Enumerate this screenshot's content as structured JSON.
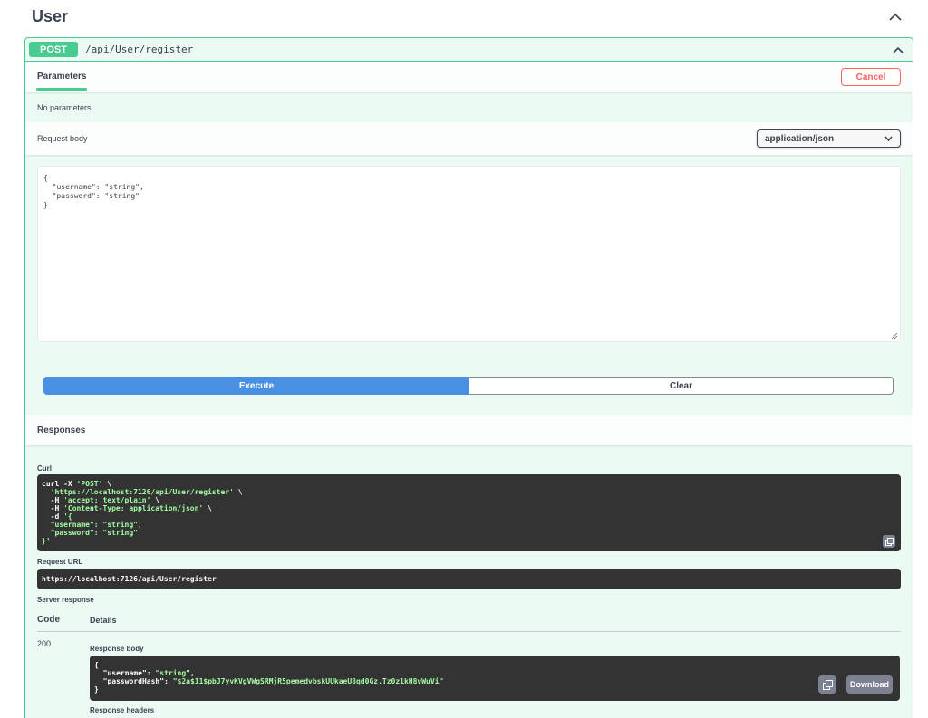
{
  "tag": {
    "title": "User"
  },
  "operation": {
    "method": "POST",
    "path": "/api/User/register"
  },
  "parameters": {
    "tab_label": "Parameters",
    "cancel_label": "Cancel",
    "no_params_text": "No parameters"
  },
  "request_body": {
    "label": "Request body",
    "content_type": "application/json",
    "editor_text": "{\n  \"username\": \"string\",\n  \"password\": \"string\"\n}"
  },
  "actions": {
    "execute_label": "Execute",
    "clear_label": "Clear"
  },
  "responses": {
    "title": "Responses",
    "curl_label": "Curl",
    "curl_lines": [
      {
        "plain": "curl -X ",
        "green": "'POST'",
        "rest": " \\"
      },
      {
        "plain": "  ",
        "green": "'https://localhost:7126/api/User/register'",
        "rest": " \\"
      },
      {
        "plain": "  -H ",
        "green": "'accept: text/plain'",
        "rest": " \\"
      },
      {
        "plain": "  -H ",
        "green": "'Content-Type: application/json'",
        "rest": " \\"
      },
      {
        "plain": "  -d ",
        "green": "'{",
        "rest": ""
      },
      {
        "plain": "",
        "green": "  \"username\": \"string\",",
        "rest": ""
      },
      {
        "plain": "",
        "green": "  \"password\": \"string\"",
        "rest": ""
      },
      {
        "plain": "",
        "green": "}'",
        "rest": ""
      }
    ],
    "request_url_label": "Request URL",
    "request_url": "https://localhost:7126/api/User/register",
    "server_response_label": "Server response",
    "code_header": "Code",
    "details_header": "Details",
    "code": "200",
    "response_body_label": "Response body",
    "response_body": {
      "open": "{",
      "line1_key": "  \"username\": ",
      "line1_val": "\"string\"",
      "line1_end": ",",
      "line2_key": "  \"passwordHash\": ",
      "line2_val": "\"$2a$11$pbJ7yvKVgVWgSRMjR5pemedvbskUUkaeU8qd0Gz.Tz0z1kH8vWuVi\"",
      "close": "}"
    },
    "download_label": "Download",
    "response_headers_label": "Response headers"
  },
  "icons": {
    "chevron": "chevron-up-icon",
    "select_arrow": "chevron-down-icon",
    "copy": "copy-icon"
  },
  "colors": {
    "post": "#49cc90",
    "execute": "#4990e2",
    "cancel": "#ff6060",
    "code_bg": "#333333"
  }
}
